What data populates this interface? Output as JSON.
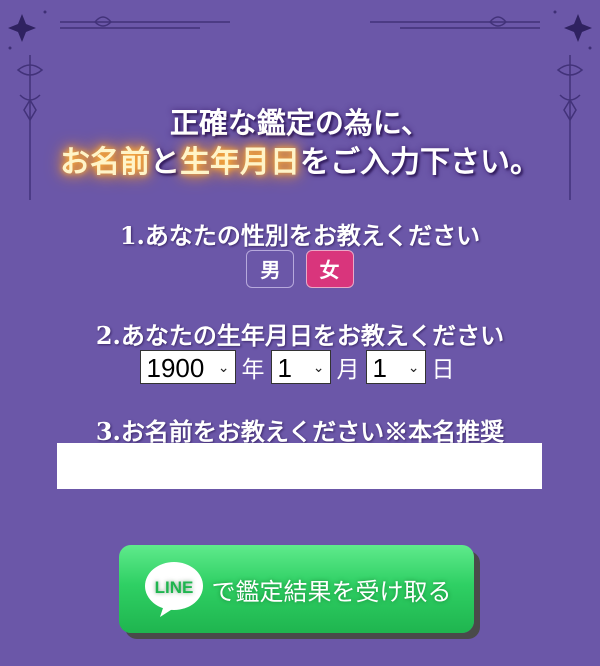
{
  "header": {
    "line1": "正確な鑑定の為に、",
    "line2_part1": "お名前",
    "line2_part2": "と",
    "line2_part3": "生年月日",
    "line2_part4": "をご入力下さい。"
  },
  "form": {
    "q1": "1.あなたの性別をお教えください",
    "male_label": "男",
    "female_label": "女",
    "selected_gender": "女",
    "q2": "2.あなたの生年月日をお教えください",
    "year_value": "1900",
    "year_unit": "年",
    "month_value": "1",
    "month_unit": "月",
    "day_value": "1",
    "day_unit": "日",
    "q3": "3.お名前をお教えください※本名推奨",
    "name_value": ""
  },
  "cta": {
    "logo_text": "LINE",
    "label": "で鑑定結果を受け取る"
  },
  "colors": {
    "background": "#6b57a8",
    "female_selected": "#d9357c",
    "line_green": "#2fd064",
    "glow": "#ff9a1f"
  },
  "icons": {
    "corner": "star-ornament-icon",
    "caret": "chevron-down-icon",
    "line": "line-logo-icon"
  }
}
